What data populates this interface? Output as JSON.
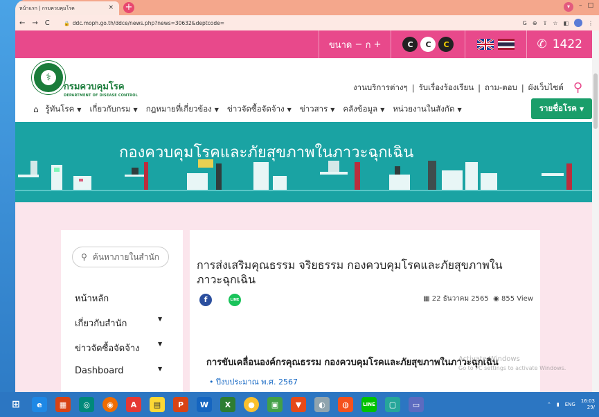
{
  "browser": {
    "tab_title": "หน้าแรก | กรมควบคุมโรค",
    "tab_close": "×",
    "new_tab": "+",
    "url": "ddc.moph.go.th/ddce/news.php?news=30632&deptcode=",
    "nav_back": "←",
    "nav_forward": "→",
    "nav_reload": "C"
  },
  "topbar": {
    "font_size_label": "ขนาด",
    "font_minus": "−",
    "font_normal": "ก",
    "font_plus": "+",
    "contrast": [
      "C",
      "C",
      "C"
    ],
    "hotline": "1422",
    "colors": {
      "pink": "#e8498b",
      "green": "#1a7c3a",
      "teal": "#1aa3a3"
    }
  },
  "header": {
    "org_name_th": "กรมควบคุมโรค",
    "org_name_en": "DEPARTMENT OF DISEASE CONTROL",
    "links": [
      "งานบริการต่างๆ",
      "รับเรื่องร้องเรียน",
      "ถาม-ตอบ",
      "ผังเว็บไซต์"
    ],
    "separator": "|"
  },
  "menu": {
    "items": [
      "รู้ทันโรค",
      "เกี่ยวกับกรม",
      "กฎหมายที่เกี่ยวข้อง",
      "ข่าวจัดซื้อจัดจ้าง",
      "ข่าวสาร",
      "คลังข้อมูล",
      "หน่วยงานในสังกัด"
    ],
    "button": "รายชื่อโรค",
    "caret": "▼"
  },
  "banner": {
    "title": "กองควบคุมโรคและภัยสุขภาพในภาวะฉุกเฉิน"
  },
  "sidebar": {
    "search_placeholder": "ค้นหาภายในสำนัก",
    "items": [
      "หน้าหลัก",
      "เกี่ยวกับสำนัก",
      "ข่าวจัดซื้อจัดจ้าง",
      "Dashboard"
    ]
  },
  "article": {
    "title": "การส่งเสริมคุณธรรม จริยธรรม กองควบคุมโรคและภัยสุขภาพในภาวะฉุกเฉิน",
    "share_facebook": "f",
    "share_line": "LINE",
    "date": "22 ธันวาคม 2565",
    "views": "855 View",
    "subheading": "การขับเคลื่อนองค์กรคุณธรรม กองควบคุมโรคและภัยสุขภาพในภาวะฉุกเฉิน",
    "bullet": "ปีงบประมาณ พ.ศ. 2567"
  },
  "overlay": {
    "activate_title": "Activate Windows",
    "activate_sub": "Go to PC settings to activate Windows."
  },
  "taskbar": {
    "lang": "ENG",
    "time": "16:03",
    "date": "29/"
  }
}
